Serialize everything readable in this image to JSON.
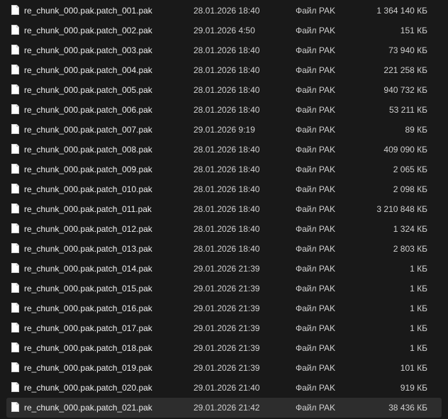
{
  "colors": {
    "background": "#191919",
    "selected_row": "#2d2d2d",
    "text": "#e6e6e6"
  },
  "files": [
    {
      "name": "re_chunk_000.pak.patch_001.pak",
      "date": "28.01.2026 18:40",
      "type": "Файл PAK",
      "size": "1 364 140 КБ",
      "icon": "file-icon"
    },
    {
      "name": "re_chunk_000.pak.patch_002.pak",
      "date": "29.01.2026 4:50",
      "type": "Файл PAK",
      "size": "151 КБ",
      "icon": "file-icon"
    },
    {
      "name": "re_chunk_000.pak.patch_003.pak",
      "date": "28.01.2026 18:40",
      "type": "Файл PAK",
      "size": "73 940 КБ",
      "icon": "file-icon"
    },
    {
      "name": "re_chunk_000.pak.patch_004.pak",
      "date": "28.01.2026 18:40",
      "type": "Файл PAK",
      "size": "221 258 КБ",
      "icon": "file-icon"
    },
    {
      "name": "re_chunk_000.pak.patch_005.pak",
      "date": "28.01.2026 18:40",
      "type": "Файл PAK",
      "size": "940 732 КБ",
      "icon": "file-icon"
    },
    {
      "name": "re_chunk_000.pak.patch_006.pak",
      "date": "28.01.2026 18:40",
      "type": "Файл PAK",
      "size": "53 211 КБ",
      "icon": "file-icon"
    },
    {
      "name": "re_chunk_000.pak.patch_007.pak",
      "date": "29.01.2026 9:19",
      "type": "Файл PAK",
      "size": "89 КБ",
      "icon": "file-icon"
    },
    {
      "name": "re_chunk_000.pak.patch_008.pak",
      "date": "28.01.2026 18:40",
      "type": "Файл PAK",
      "size": "409 090 КБ",
      "icon": "file-icon"
    },
    {
      "name": "re_chunk_000.pak.patch_009.pak",
      "date": "28.01.2026 18:40",
      "type": "Файл PAK",
      "size": "2 065 КБ",
      "icon": "file-icon"
    },
    {
      "name": "re_chunk_000.pak.patch_010.pak",
      "date": "28.01.2026 18:40",
      "type": "Файл PAK",
      "size": "2 098 КБ",
      "icon": "file-icon"
    },
    {
      "name": "re_chunk_000.pak.patch_011.pak",
      "date": "28.01.2026 18:40",
      "type": "Файл PAK",
      "size": "3 210 848 КБ",
      "icon": "file-icon"
    },
    {
      "name": "re_chunk_000.pak.patch_012.pak",
      "date": "28.01.2026 18:40",
      "type": "Файл PAK",
      "size": "1 324 КБ",
      "icon": "file-icon"
    },
    {
      "name": "re_chunk_000.pak.patch_013.pak",
      "date": "28.01.2026 18:40",
      "type": "Файл PAK",
      "size": "2 803 КБ",
      "icon": "file-icon"
    },
    {
      "name": "re_chunk_000.pak.patch_014.pak",
      "date": "29.01.2026 21:39",
      "type": "Файл PAK",
      "size": "1 КБ",
      "icon": "file-icon"
    },
    {
      "name": "re_chunk_000.pak.patch_015.pak",
      "date": "29.01.2026 21:39",
      "type": "Файл PAK",
      "size": "1 КБ",
      "icon": "file-icon"
    },
    {
      "name": "re_chunk_000.pak.patch_016.pak",
      "date": "29.01.2026 21:39",
      "type": "Файл PAK",
      "size": "1 КБ",
      "icon": "file-icon"
    },
    {
      "name": "re_chunk_000.pak.patch_017.pak",
      "date": "29.01.2026 21:39",
      "type": "Файл PAK",
      "size": "1 КБ",
      "icon": "file-icon"
    },
    {
      "name": "re_chunk_000.pak.patch_018.pak",
      "date": "29.01.2026 21:39",
      "type": "Файл PAK",
      "size": "1 КБ",
      "icon": "file-icon"
    },
    {
      "name": "re_chunk_000.pak.patch_019.pak",
      "date": "29.01.2026 21:39",
      "type": "Файл PAK",
      "size": "101 КБ",
      "icon": "file-icon"
    },
    {
      "name": "re_chunk_000.pak.patch_020.pak",
      "date": "29.01.2026 21:40",
      "type": "Файл PAK",
      "size": "919 КБ",
      "icon": "file-icon"
    },
    {
      "name": "re_chunk_000.pak.patch_021.pak",
      "date": "29.01.2026 21:42",
      "type": "Файл PAK",
      "size": "38 436 КБ",
      "icon": "file-icon",
      "selected": true
    }
  ]
}
